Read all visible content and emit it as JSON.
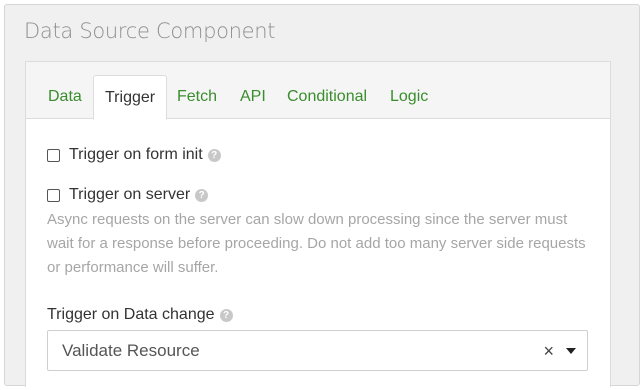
{
  "title": "Data Source Component",
  "tabs": [
    {
      "label": "Data"
    },
    {
      "label": "Trigger"
    },
    {
      "label": "Fetch"
    },
    {
      "label": "API"
    },
    {
      "label": "Conditional"
    },
    {
      "label": "Logic"
    }
  ],
  "trigger_form_init": {
    "label": "Trigger on form init",
    "help": "?"
  },
  "trigger_server": {
    "label": "Trigger on server",
    "help": "?"
  },
  "server_description": "Async requests on the server can slow down processing since the server must wait for a response before proceeding. Do not add too many server side requests or performance will suffer.",
  "trigger_data_change": {
    "label": "Trigger on Data change",
    "help": "?",
    "value": "Validate Resource",
    "clear": "×"
  }
}
